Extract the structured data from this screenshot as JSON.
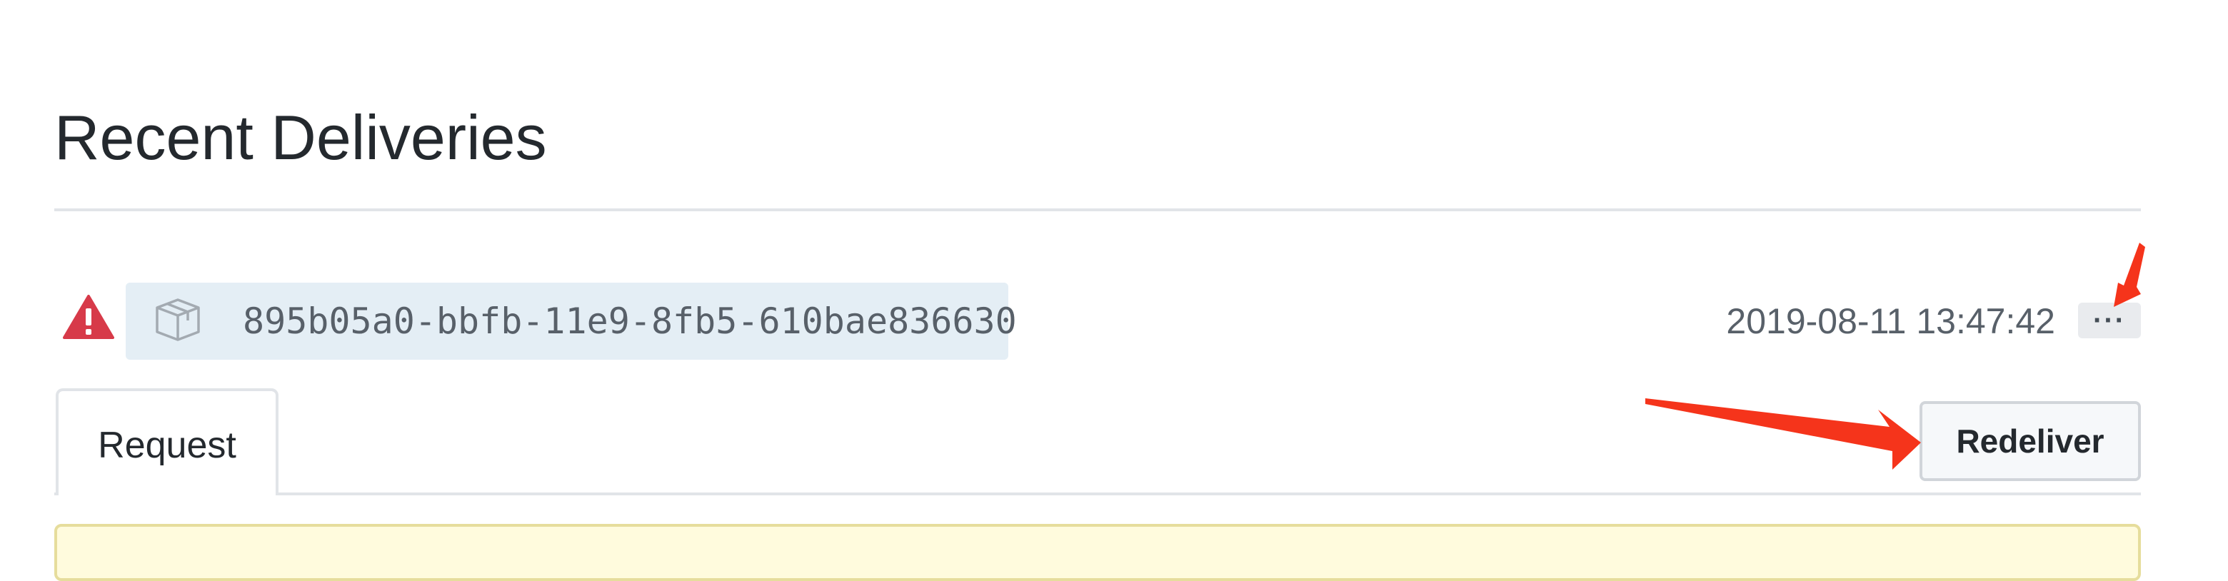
{
  "page": {
    "title": "Recent Deliveries"
  },
  "delivery": {
    "status_icon": "alert-icon",
    "guid_icon": "package-icon",
    "guid": "895b05a0-bbfb-11e9-8fb5-610bae836630",
    "timestamp": "2019-08-11 13:47:42",
    "more_label": "···"
  },
  "tabs": [
    {
      "label": "Request"
    }
  ],
  "actions": {
    "redeliver_label": "Redeliver"
  },
  "colors": {
    "alert": "#d73a49",
    "guid_background": "#e4eef5",
    "annotation_arrow": "#f5341b",
    "flash_background": "#fffbdd"
  }
}
